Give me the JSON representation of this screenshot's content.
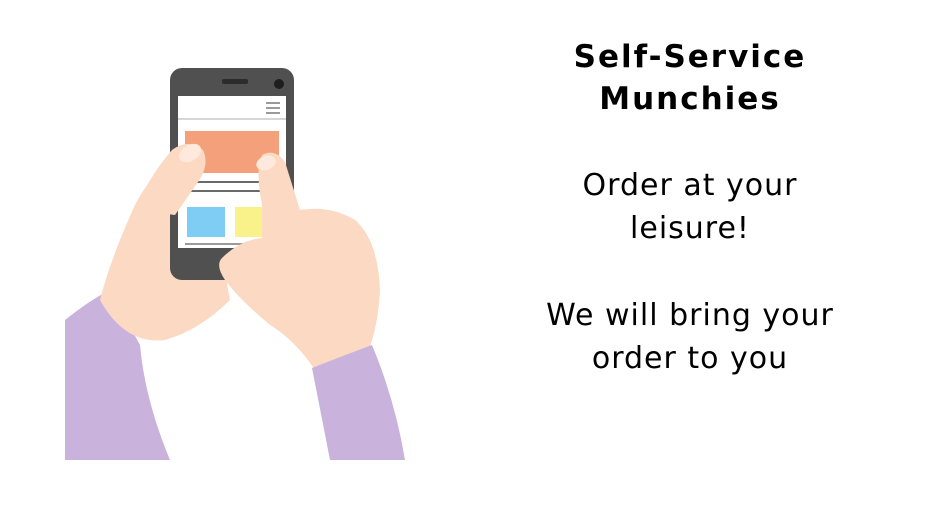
{
  "slide": {
    "title_line1": "Self-Service",
    "title_line2": "Munchies",
    "tagline1_line1": "Order at your",
    "tagline1_line2": "leisure!",
    "tagline2_line1": "We will bring your",
    "tagline2_line2": "order to you"
  },
  "illustration": {
    "icon": "hands-holding-smartphone-icon",
    "colors": {
      "phone_body": "#505050",
      "screen": "#ffffff",
      "banner": "#f4a07a",
      "tile_blue": "#7fcdf5",
      "tile_yellow": "#f9f18a",
      "skin": "#fcd9c3",
      "sleeve": "#c9b3dd"
    }
  }
}
